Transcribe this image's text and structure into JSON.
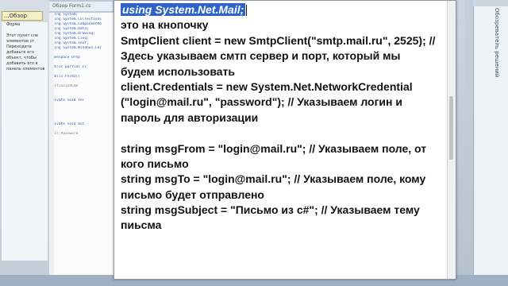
{
  "ide": {
    "left_tab_label": "...Обзор",
    "left_panel_lines": [
      "Форма",
      "",
      "Этот пункт сле",
      "элементов ст",
      "Переходите",
      "добавьте его",
      "объект, чтобы",
      "добавить его в",
      "панель элементов"
    ],
    "editor_tab_label": "Обзор Form1.cs",
    "code_lines": [
      {
        "text": "using System;",
        "cls": "kw"
      },
      {
        "text": "using System.Collections",
        "cls": "kw"
      },
      {
        "text": "using System.ComponentMo",
        "cls": "kw"
      },
      {
        "text": "using System.Data;",
        "cls": "kw"
      },
      {
        "text": "using System.Drawing;",
        "cls": "kw"
      },
      {
        "text": "using System.Linq;",
        "cls": "kw"
      },
      {
        "text": "using System.Text;",
        "cls": "kw"
      },
      {
        "text": "using System.Windows.For",
        "cls": "kw"
      },
      {
        "text": "",
        "cls": ""
      },
      {
        "text": "namespace Отпр",
        "cls": "kw"
      },
      {
        "text": "{",
        "cls": "gray"
      },
      {
        "text": "  public partial cl",
        "cls": "kw"
      },
      {
        "text": "  {",
        "cls": "gray"
      },
      {
        "text": "    public Form1()",
        "cls": "kw"
      },
      {
        "text": "    {",
        "cls": "gray"
      },
      {
        "text": "      InitializeCom",
        "cls": "gray"
      },
      {
        "text": "    }",
        "cls": "gray"
      },
      {
        "text": "",
        "cls": ""
      },
      {
        "text": "    private void for",
        "cls": "kw"
      },
      {
        "text": "    {",
        "cls": "gray"
      },
      {
        "text": "",
        "cls": ""
      },
      {
        "text": "    }",
        "cls": "gray"
      },
      {
        "text": "",
        "cls": ""
      },
      {
        "text": "    private void but",
        "cls": "kw"
      },
      {
        "text": "    {",
        "cls": "gray"
      },
      {
        "text": "      this.Password",
        "cls": "gray"
      },
      {
        "text": "    }",
        "cls": "gray"
      }
    ],
    "right_panel_label": "Обозреватель решений"
  },
  "note": {
    "highlighted_line": "using System.Net.Mail;",
    "lines": [
      "это на кнопочку",
      "SmtpClient client = new SmtpClient(\"smtp.mail.ru\", 2525); //",
      "Здесь указываем смтп сервер и порт, который мы",
      "будем использовать",
      "client.Credentials = new System.Net.NetworkCredential",
      "(\"login@mail.ru\", \"password\"); // Указываем логин и",
      "пароль для авторизации",
      "",
      "string msgFrom = \"login@mail.ru\"; // Указываем поле, от",
      "кого письмо",
      "string msgTo = \"login@mail.ru\"; // Указываем поле, кому",
      "письмо будет отправлено",
      "string msgSubject = \"Письмо из с#\"; // Указываем тему",
      "пиьсма"
    ]
  }
}
